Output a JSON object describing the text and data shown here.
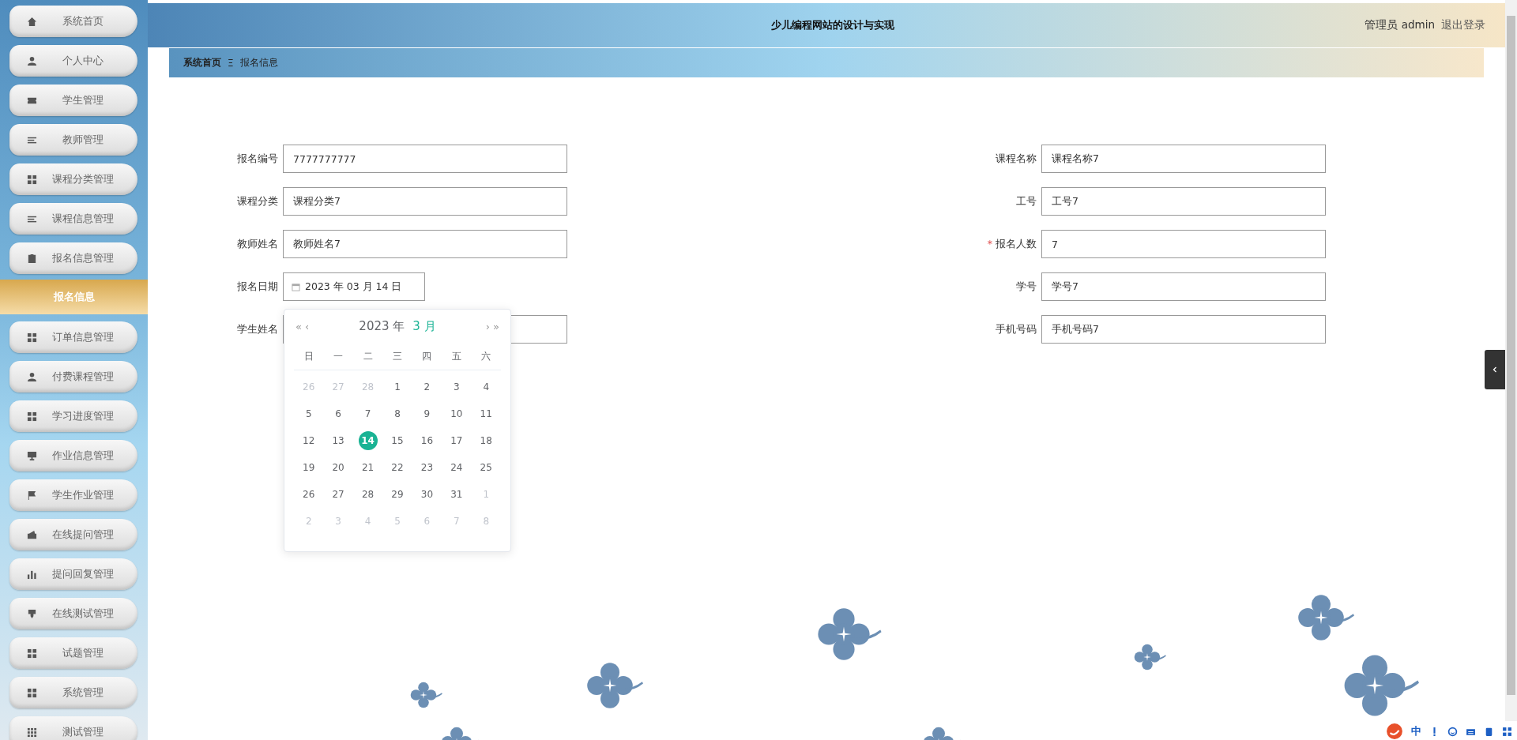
{
  "sidebar": {
    "items": [
      {
        "label": "系统首页",
        "kind": "menu",
        "selected": false
      },
      {
        "label": "个人中心",
        "kind": "menu",
        "selected": false
      },
      {
        "label": "学生管理",
        "kind": "menu",
        "selected": false
      },
      {
        "label": "教师管理",
        "kind": "menu",
        "selected": false
      },
      {
        "label": "课程分类管理",
        "kind": "menu",
        "selected": false
      },
      {
        "label": "课程信息管理",
        "kind": "menu",
        "selected": false
      },
      {
        "label": "报名信息管理",
        "kind": "menu",
        "selected": false
      },
      {
        "label": "报名信息",
        "kind": "submenu",
        "selected": true
      },
      {
        "label": "订单信息管理",
        "kind": "menu",
        "selected": false
      },
      {
        "label": "付费课程管理",
        "kind": "menu",
        "selected": false
      },
      {
        "label": "学习进度管理",
        "kind": "menu",
        "selected": false
      },
      {
        "label": "作业信息管理",
        "kind": "menu",
        "selected": false
      },
      {
        "label": "学生作业管理",
        "kind": "menu",
        "selected": false
      },
      {
        "label": "在线提问管理",
        "kind": "menu",
        "selected": false
      },
      {
        "label": "提问回复管理",
        "kind": "menu",
        "selected": false
      },
      {
        "label": "在线测试管理",
        "kind": "menu",
        "selected": false
      },
      {
        "label": "试题管理",
        "kind": "menu",
        "selected": false
      },
      {
        "label": "系统管理",
        "kind": "menu",
        "selected": false
      },
      {
        "label": "测试管理",
        "kind": "menu",
        "selected": false
      }
    ]
  },
  "header": {
    "title": "少儿编程网站的设计与实现",
    "user": "管理员 admin",
    "logout": "退出登录"
  },
  "breadcrumb": {
    "home": "系统首页",
    "separator": "Ξ",
    "current": "报名信息"
  },
  "form": {
    "required_mark": "*",
    "left": [
      {
        "label": "报名编号",
        "value": "7777777777",
        "kind": "text",
        "required": false
      },
      {
        "label": "课程分类",
        "value": "课程分类7",
        "kind": "text",
        "required": false
      },
      {
        "label": "教师姓名",
        "value": "教师姓名7",
        "kind": "text",
        "required": false
      },
      {
        "label": "报名日期",
        "value": "2023 年 03 月 14 日",
        "kind": "date",
        "required": false
      },
      {
        "label": "学生姓名",
        "kind": "text",
        "required": false
      }
    ],
    "right": [
      {
        "label": "课程名称",
        "value": "课程名称7",
        "kind": "text",
        "required": false
      },
      {
        "label": "工号",
        "value": "工号7",
        "kind": "text",
        "required": false
      },
      {
        "label": "报名人数",
        "value": "7",
        "kind": "text",
        "required": true
      },
      {
        "label": "学号",
        "value": "学号7",
        "kind": "text",
        "required": false
      },
      {
        "label": "手机号码",
        "value": "手机号码7",
        "kind": "text",
        "required": false
      }
    ]
  },
  "calendar": {
    "prev_year": "«",
    "prev_month": "‹",
    "year": "2023 年",
    "month": "3 月",
    "next_month": "›",
    "next_year": "»",
    "weekdays": [
      "日",
      "一",
      "二",
      "三",
      "四",
      "五",
      "六"
    ],
    "weeks": [
      [
        {
          "day": "26",
          "muted": true,
          "selected": false
        },
        {
          "day": "27",
          "muted": true,
          "selected": false
        },
        {
          "day": "28",
          "muted": true,
          "selected": false
        },
        {
          "day": "1",
          "muted": false,
          "selected": false
        },
        {
          "day": "2",
          "muted": false,
          "selected": false
        },
        {
          "day": "3",
          "muted": false,
          "selected": false
        },
        {
          "day": "4",
          "muted": false,
          "selected": false
        }
      ],
      [
        {
          "day": "5",
          "muted": false,
          "selected": false
        },
        {
          "day": "6",
          "muted": false,
          "selected": false
        },
        {
          "day": "7",
          "muted": false,
          "selected": false
        },
        {
          "day": "8",
          "muted": false,
          "selected": false
        },
        {
          "day": "9",
          "muted": false,
          "selected": false
        },
        {
          "day": "10",
          "muted": false,
          "selected": false
        },
        {
          "day": "11",
          "muted": false,
          "selected": false
        }
      ],
      [
        {
          "day": "12",
          "muted": false,
          "selected": false
        },
        {
          "day": "13",
          "muted": false,
          "selected": false
        },
        {
          "day": "14",
          "muted": false,
          "selected": true
        },
        {
          "day": "15",
          "muted": false,
          "selected": false
        },
        {
          "day": "16",
          "muted": false,
          "selected": false
        },
        {
          "day": "17",
          "muted": false,
          "selected": false
        },
        {
          "day": "18",
          "muted": false,
          "selected": false
        }
      ],
      [
        {
          "day": "19",
          "muted": false,
          "selected": false
        },
        {
          "day": "20",
          "muted": false,
          "selected": false
        },
        {
          "day": "21",
          "muted": false,
          "selected": false
        },
        {
          "day": "22",
          "muted": false,
          "selected": false
        },
        {
          "day": "23",
          "muted": false,
          "selected": false
        },
        {
          "day": "24",
          "muted": false,
          "selected": false
        },
        {
          "day": "25",
          "muted": false,
          "selected": false
        }
      ],
      [
        {
          "day": "26",
          "muted": false,
          "selected": false
        },
        {
          "day": "27",
          "muted": false,
          "selected": false
        },
        {
          "day": "28",
          "muted": false,
          "selected": false
        },
        {
          "day": "29",
          "muted": false,
          "selected": false
        },
        {
          "day": "30",
          "muted": false,
          "selected": false
        },
        {
          "day": "31",
          "muted": false,
          "selected": false
        },
        {
          "day": "1",
          "muted": true,
          "selected": false
        }
      ],
      [
        {
          "day": "2",
          "muted": true,
          "selected": false
        },
        {
          "day": "3",
          "muted": true,
          "selected": false
        },
        {
          "day": "4",
          "muted": true,
          "selected": false
        },
        {
          "day": "5",
          "muted": true,
          "selected": false
        },
        {
          "day": "6",
          "muted": true,
          "selected": false
        },
        {
          "day": "7",
          "muted": true,
          "selected": false
        },
        {
          "day": "8",
          "muted": true,
          "selected": false
        }
      ]
    ]
  },
  "ime": {
    "mode": "中"
  }
}
